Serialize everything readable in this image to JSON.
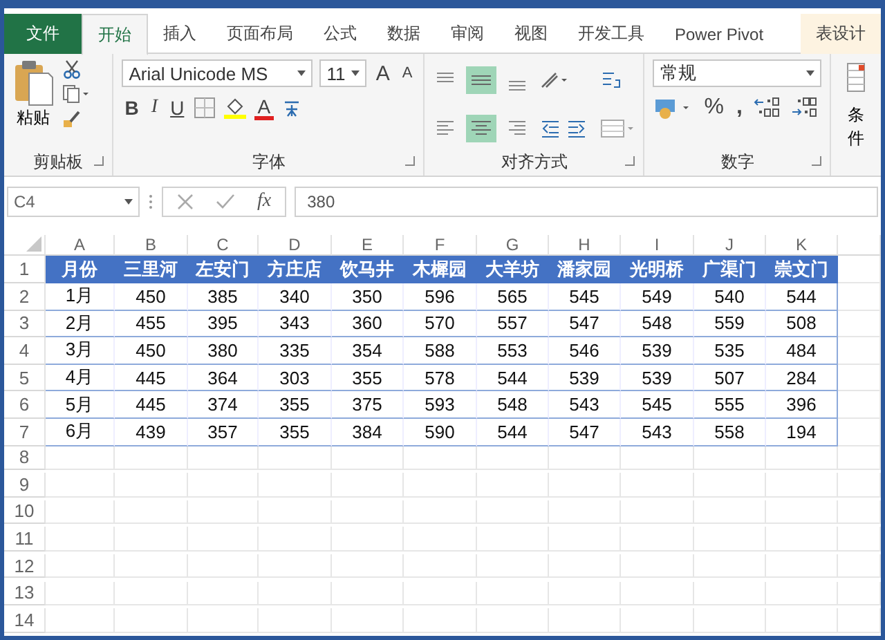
{
  "tabs": [
    {
      "label": "文件",
      "kind": "file",
      "selected": false
    },
    {
      "label": "开始",
      "kind": "normal",
      "selected": true
    },
    {
      "label": "插入",
      "kind": "normal",
      "selected": false
    },
    {
      "label": "页面布局",
      "kind": "normal",
      "selected": false
    },
    {
      "label": "公式",
      "kind": "normal",
      "selected": false
    },
    {
      "label": "数据",
      "kind": "normal",
      "selected": false
    },
    {
      "label": "审阅",
      "kind": "normal",
      "selected": false
    },
    {
      "label": "视图",
      "kind": "normal",
      "selected": false
    },
    {
      "label": "开发工具",
      "kind": "normal",
      "selected": false
    },
    {
      "label": "Power Pivot",
      "kind": "normal",
      "selected": false
    },
    {
      "label": "表设计",
      "kind": "contextual",
      "selected": false
    }
  ],
  "ribbon": {
    "clipboard": {
      "paste_label": "粘贴",
      "group_label": "剪贴板"
    },
    "font": {
      "font_name": "Arial Unicode MS",
      "font_size": "11",
      "grow": "A",
      "shrink": "A",
      "bold": "B",
      "italic": "I",
      "underline": "U",
      "font_color": "A",
      "group_label": "字体"
    },
    "alignment": {
      "group_label": "对齐方式"
    },
    "number": {
      "format": "常规",
      "percent": "%",
      "comma": ",",
      "group_label": "数字"
    },
    "styles": {
      "conditional_label": "条件"
    }
  },
  "formula_bar": {
    "name_box": "C4",
    "fx": "fx",
    "formula": "380"
  },
  "sheet": {
    "columns": [
      "A",
      "B",
      "C",
      "D",
      "E",
      "F",
      "G",
      "H",
      "I",
      "J",
      "K"
    ],
    "row_numbers": [
      "1",
      "2",
      "3",
      "4",
      "5",
      "6",
      "7",
      "8",
      "9",
      "10",
      "11",
      "12",
      "13",
      "14"
    ],
    "table": {
      "header": [
        "月份",
        "三里河",
        "左安门",
        "方庄店",
        "饮马井",
        "木樨园",
        "大羊坊",
        "潘家园",
        "光明桥",
        "广渠门",
        "崇文门"
      ],
      "rows": [
        [
          "1月",
          "450",
          "385",
          "340",
          "350",
          "596",
          "565",
          "545",
          "549",
          "540",
          "544"
        ],
        [
          "2月",
          "455",
          "395",
          "343",
          "360",
          "570",
          "557",
          "547",
          "548",
          "559",
          "508"
        ],
        [
          "3月",
          "450",
          "380",
          "335",
          "354",
          "588",
          "553",
          "546",
          "539",
          "535",
          "484"
        ],
        [
          "4月",
          "445",
          "364",
          "303",
          "355",
          "578",
          "544",
          "539",
          "539",
          "507",
          "284"
        ],
        [
          "5月",
          "445",
          "374",
          "355",
          "375",
          "593",
          "548",
          "543",
          "545",
          "555",
          "396"
        ],
        [
          "6月",
          "439",
          "357",
          "355",
          "384",
          "590",
          "544",
          "547",
          "543",
          "558",
          "194"
        ]
      ]
    }
  }
}
